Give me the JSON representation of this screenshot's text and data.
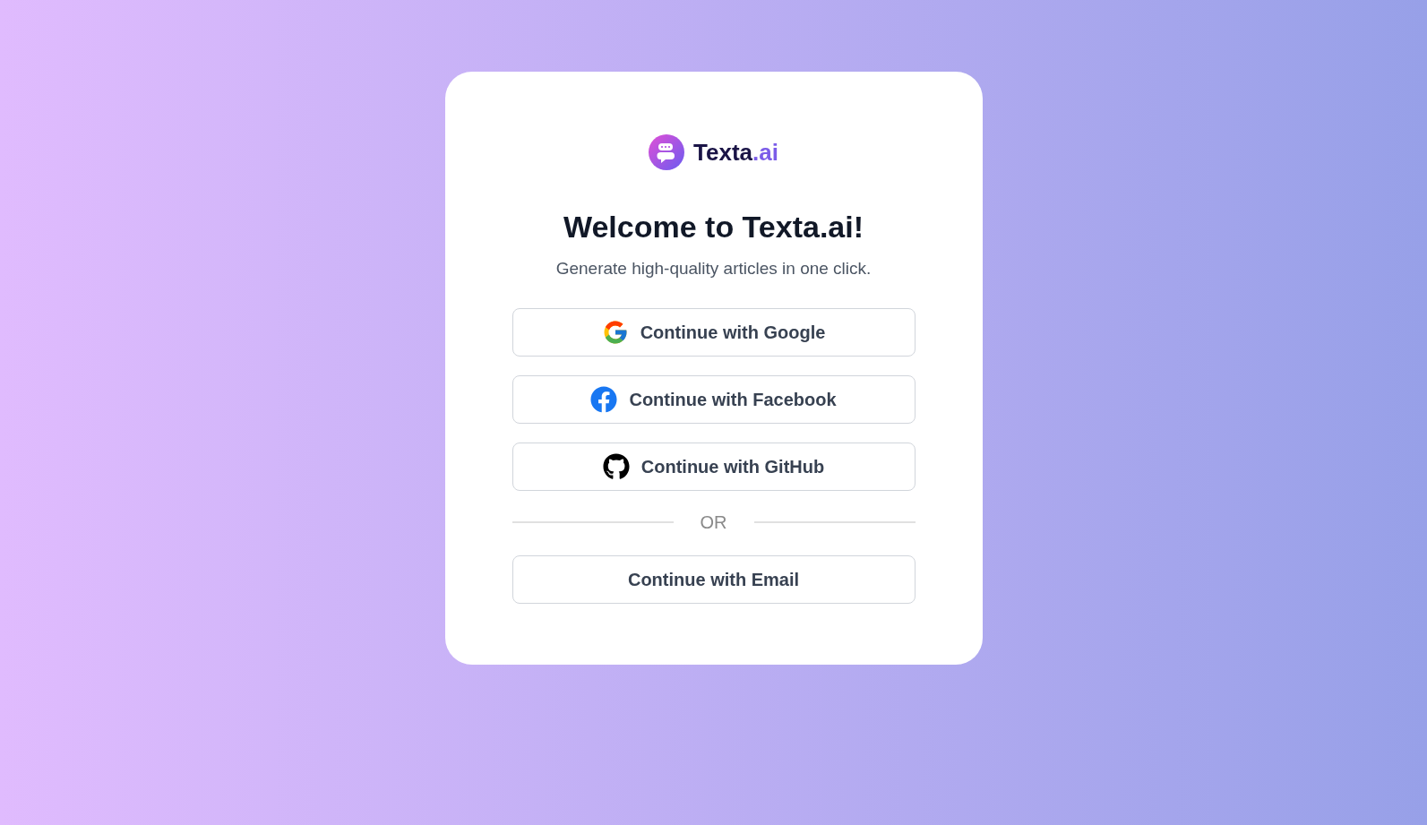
{
  "logo": {
    "name": "Texta",
    "suffix": ".ai"
  },
  "heading": "Welcome to Texta.ai!",
  "subtitle": "Generate high-quality articles in one click.",
  "providers": [
    {
      "kind": "google",
      "label": "Continue with Google"
    },
    {
      "kind": "facebook",
      "label": "Continue with Facebook"
    },
    {
      "kind": "github",
      "label": "Continue with GitHub"
    }
  ],
  "divider": "OR",
  "email_button": "Continue with Email"
}
